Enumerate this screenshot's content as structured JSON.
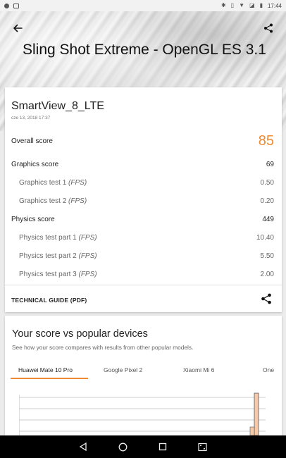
{
  "status_bar": {
    "time": "17:44"
  },
  "header": {
    "title": "Sling Shot Extreme - OpenGL ES 3.1"
  },
  "result": {
    "device": "SmartView_8_LTE",
    "date": "cze 13, 2018 17:37",
    "overall": {
      "label": "Overall score",
      "value": "85"
    },
    "graphics": {
      "label": "Graphics score",
      "value": "69"
    },
    "graphics_tests": [
      {
        "label": "Graphics test 1",
        "unit": "(FPS)",
        "value": "0.50"
      },
      {
        "label": "Graphics test 2",
        "unit": "(FPS)",
        "value": "0.20"
      }
    ],
    "physics": {
      "label": "Physics score",
      "value": "449"
    },
    "physics_tests": [
      {
        "label": "Physics test part 1",
        "unit": "(FPS)",
        "value": "10.40"
      },
      {
        "label": "Physics test part 2",
        "unit": "(FPS)",
        "value": "5.50"
      },
      {
        "label": "Physics test part 3",
        "unit": "(FPS)",
        "value": "2.00"
      }
    ],
    "tech_guide": "TECHNICAL GUIDE (PDF)"
  },
  "compare": {
    "title": "Your score vs popular devices",
    "subtitle": "See how your score compares with results from other popular models.",
    "tabs": [
      "Huawei Mate 10 Pro",
      "Google Pixel 2",
      "Xiaomi Mi 6",
      "One"
    ],
    "active_tab": 0
  },
  "colors": {
    "accent": "#f08a30",
    "bar_fill": "#f6c9a8"
  },
  "icons": [
    "back-arrow-icon",
    "share-icon",
    "back-triangle-icon",
    "home-circle-icon",
    "recents-square-icon",
    "screenshot-icon"
  ]
}
